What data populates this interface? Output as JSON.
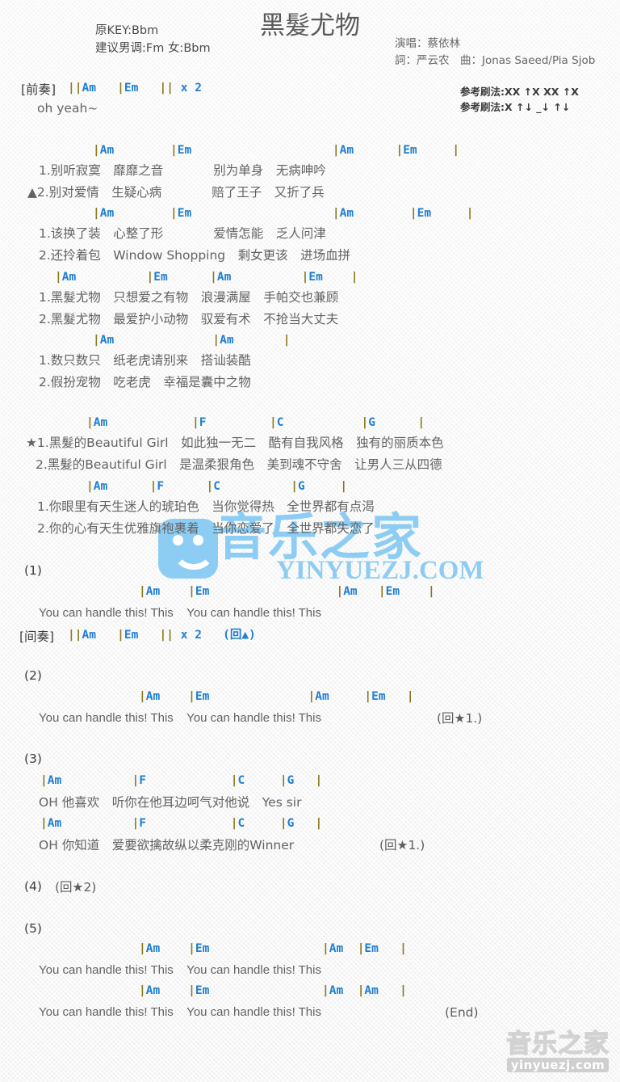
{
  "header": {
    "title": "黑髮尤物",
    "key_original": "原KEY:Bbm",
    "key_suggest": "建议男调:Fm 女:Bbm",
    "singer": "演唱：蔡依林",
    "writers": "詞：严云农　曲：Jonas Saeed/Pia Sjob",
    "strum1": "参考刷法:XX ↑X XX ↑X",
    "strum2": "参考刷法:X ↑↓ _↓ ↑↓"
  },
  "intro": {
    "label": "[前奏]",
    "chords": "||Am   |Em   || x 2",
    "lyric": "oh yeah~"
  },
  "verse1": {
    "chords": "|Am        |Em                    |Am      |Em     |",
    "line1": "1.别听寂寞　靡靡之音　　　　别为单身　无病呻吟",
    "line2": "▲2.别对爱情　生疑心病　　　　赔了王子　又折了兵"
  },
  "verse2": {
    "chords": "|Am        |Em                    |Am        |Em     |",
    "line1": "1.该换了装　心整了形　　　　爱情怎能　乏人问津",
    "line2": "2.还拎着包　Window Shopping　剩女更该　进场血拼"
  },
  "verse3": {
    "chords": "|Am          |Em      |Am          |Em    |",
    "line1": "1.黑髮尤物　只想爱之有物　浪漫满屋　手帕交也兼顾",
    "line2": "2.黑髮尤物　最爱护小动物　驭爱有术　不抢当大丈夫"
  },
  "verse4": {
    "chords": "|Am              |Am       |",
    "line1": "1.数只数只　纸老虎请别来　搭讪装酷",
    "line2": "2.假扮宠物　吃老虎　幸福是囊中之物"
  },
  "chorus1": {
    "chords": "|Am            |F         |C           |G      |",
    "line1": "★1.黑髮的Beautiful Girl　如此独一无二　酷有自我风格　独有的丽质本色",
    "line2": "2.黑髮的Beautiful Girl　是温柔狠角色　美到魂不守舍　让男人三从四德"
  },
  "chorus2": {
    "chords": "|Am      |F      |C          |G     |",
    "line1": "1.你眼里有天生迷人的琥珀色　当你觉得热　全世界都有点渴",
    "line2": "2.你的心有天生优雅旗袍裹着　当你恋爱了　全世界都失恋了"
  },
  "section1": {
    "label": "(1)",
    "chords": "|Am    |Em                  |Am   |Em    |",
    "lyric": "You can handle this! This    You can handle this! This",
    "interlude_label": "[间奏]",
    "interlude_chords": "||Am   |Em   || x 2   (回▲)"
  },
  "section2": {
    "label": "(2)",
    "chords": "|Am    |Em              |Am     |Em   |",
    "lyric": "You can handle this! This    You can handle this! This",
    "repeat": "(回★1.)"
  },
  "section3": {
    "label": "(3)",
    "chords_a": "|Am          |F            |C     |G   |",
    "lyric_a": "OH 他喜欢　听你在他耳边呵气对他说　Yes sir",
    "chords_b": "|Am          |F            |C     |G   |",
    "lyric_b": "OH 你知道　爱要欲擒故纵以柔克刚的Winner",
    "repeat_b": "(回★1.)"
  },
  "section4": {
    "label": "(4)",
    "repeat": "(回★2)"
  },
  "section5": {
    "label": "(5)",
    "chords_a": "|Am    |Em                |Am  |Em   |",
    "lyric_a": "You can handle this! This    You can handle this! This",
    "chords_b": "|Am    |Em                |Am  |Am   |",
    "lyric_b": "You can handle this! This    You can handle this! This",
    "end": "(End)"
  },
  "watermark": {
    "center_text": "音乐之家",
    "center_url": "YINYUEZJ.COM",
    "bottom_text": "音乐之家",
    "bottom_url": "yinyuezj.com",
    "color": "#8ecdf3"
  }
}
